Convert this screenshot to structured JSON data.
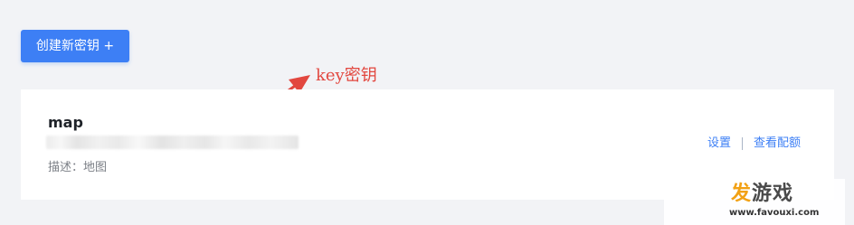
{
  "toolbar": {
    "create_key_label": "创建新密钥 +"
  },
  "annotation": {
    "label": "key密钥",
    "color": "#e2473f"
  },
  "key_card": {
    "name": "map",
    "key_value": "",
    "key_value_note": "blurred/redacted",
    "description": "描述：地图",
    "actions": {
      "settings": "设置",
      "view_quota": "查看配额"
    }
  },
  "watermark": {
    "title_accent": "发",
    "title_rest": "游戏",
    "url": "www.favouxi.com"
  },
  "colors": {
    "primary": "#3d7ff5",
    "background": "#f2f3f6",
    "card": "#ffffff",
    "annotation": "#e2473f",
    "watermark_accent": "#f2a114"
  },
  "icons": {
    "annotation_arrow": "arrow-up-right-icon"
  }
}
